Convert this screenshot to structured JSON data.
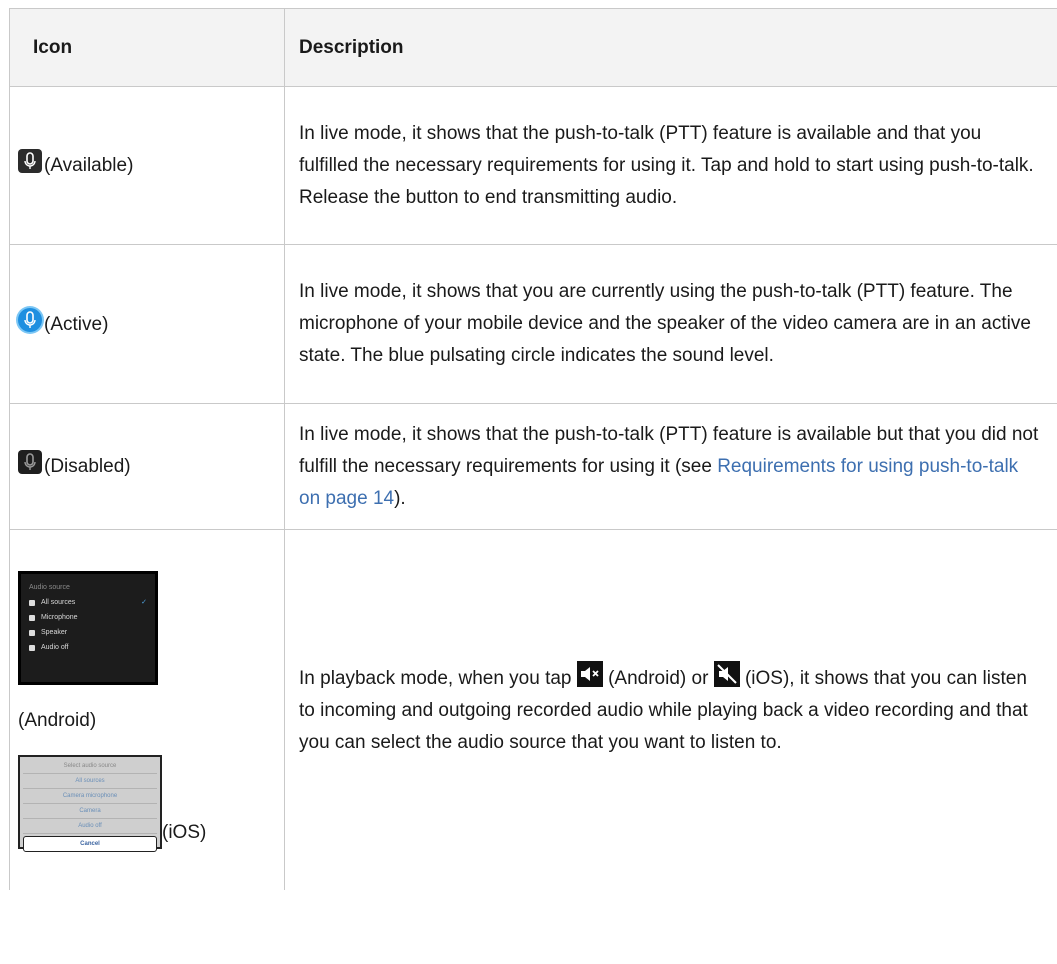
{
  "table": {
    "headers": {
      "icon": "Icon",
      "description": "Description"
    },
    "rows": [
      {
        "icon_label": "(Available)",
        "description": "In live mode, it shows that the push-to-talk (PTT) feature is available and that you fulfilled the necessary requirements for using it. Tap and hold to start using push-to-talk. Release the button to end transmitting audio."
      },
      {
        "icon_label": "(Active)",
        "description": "In live mode, it shows that you are currently using the push-to-talk (PTT) feature. The microphone of your mobile device and the speaker of the video camera are in an active state. The blue pulsating circle indicates the sound level."
      },
      {
        "icon_label": "(Disabled)",
        "description_before": "In live mode, it shows that the push-to-talk (PTT) feature is available but that you did not fulfill the necessary requirements for using it (see ",
        "link_text": "Requirements for using push-to-talk on page 14",
        "description_after": ")."
      },
      {
        "android_label": "(Android)",
        "ios_label": "(iOS)",
        "android_screenshot": {
          "title": "Audio source",
          "items": [
            "All sources",
            "Microphone",
            "Speaker",
            "Audio off"
          ]
        },
        "ios_screenshot": {
          "title": "Select audio source",
          "items": [
            "All sources",
            "Camera microphone",
            "Camera",
            "Audio off"
          ],
          "cancel": "Cancel"
        },
        "desc_part1": "In playback mode, when you tap ",
        "desc_part2": " (Android) or ",
        "desc_part3": " (iOS), it shows that you can listen to incoming and outgoing recorded audio while playing back a video recording and that you can select the audio source that you want to listen to."
      }
    ]
  },
  "colors": {
    "link": "#3d6fb0",
    "active_mic": "#1e8fe0",
    "header_bg": "#f3f3f3"
  }
}
